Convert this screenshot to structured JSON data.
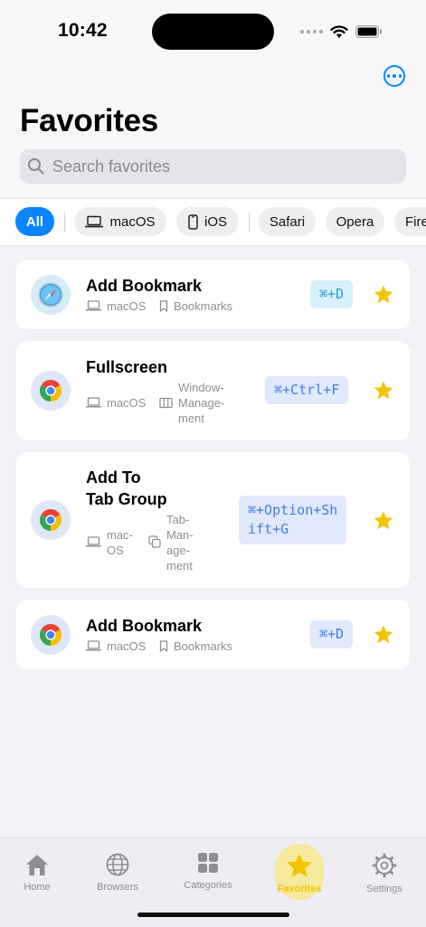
{
  "status_bar": {
    "time": "10:42"
  },
  "header": {
    "title": "Favorites",
    "search_placeholder": "Search favorites",
    "more_icon": "ellipsis-circle-icon"
  },
  "filters": [
    {
      "label": "All",
      "active": true,
      "icon": ""
    },
    {
      "label": "macOS",
      "active": false,
      "icon": "laptop-icon"
    },
    {
      "label": "iOS",
      "active": false,
      "icon": "iphone-icon"
    },
    {
      "label": "Safari",
      "active": false,
      "icon": ""
    },
    {
      "label": "Opera",
      "active": false,
      "icon": ""
    },
    {
      "label": "Fire",
      "active": false,
      "icon": ""
    }
  ],
  "shortcuts": [
    {
      "title": "Add Bookmark",
      "browser_icon": "safari-icon",
      "platform": "macOS",
      "category": "Bookmarks",
      "keys": "⌘+D",
      "favorite": true
    },
    {
      "title": "Fullscreen",
      "browser_icon": "chrome-icon",
      "platform": "macOS",
      "category_lines": [
        "Window-",
        "Manage-",
        "ment"
      ],
      "keys": "⌘+Ctrl+F",
      "favorite": true
    },
    {
      "title_lines": [
        "Add To",
        "Tab Group"
      ],
      "browser_icon": "chrome-icon",
      "platform_lines": [
        "mac-",
        "OS"
      ],
      "category_lines": [
        "Tab-",
        "Man-",
        "age-",
        "ment"
      ],
      "keys_lines": [
        "⌘+Option+Sh",
        "ift+G"
      ],
      "favorite": true
    },
    {
      "title": "Add Bookmark",
      "browser_icon": "chrome-icon",
      "platform": "macOS",
      "category": "Bookmarks",
      "keys": "⌘+D",
      "favorite": true
    }
  ],
  "tabbar": {
    "items": [
      {
        "label": "Home",
        "icon": "house-icon"
      },
      {
        "label": "Browsers",
        "icon": "globe-icon"
      },
      {
        "label": "Categories",
        "icon": "grid-icon"
      },
      {
        "label": "Favorites",
        "icon": "star-icon",
        "active": true
      },
      {
        "label": "Settings",
        "icon": "gear-icon"
      }
    ]
  },
  "colors": {
    "accent": "#0a84ff",
    "star": "#f5c400",
    "background": "#f2f2f7"
  }
}
